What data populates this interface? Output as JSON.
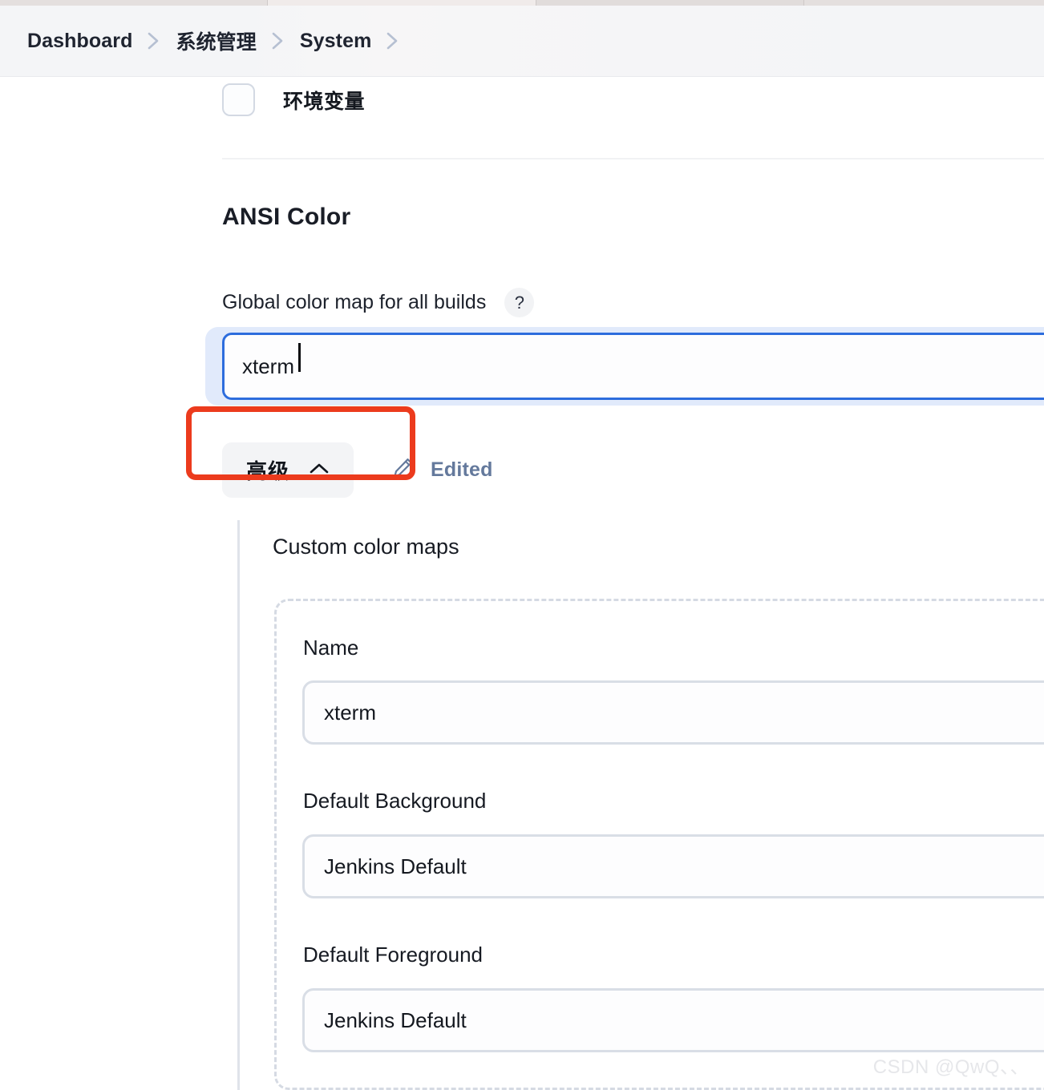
{
  "browser": {
    "tabs": [
      "tab-inactive-left",
      "tab-active",
      "tab-inactive-right",
      "tab-inactive-far-right"
    ]
  },
  "breadcrumb": {
    "items": [
      {
        "label": "Dashboard"
      },
      {
        "label": "系统管理"
      },
      {
        "label": "System"
      }
    ],
    "separator_icon": "chevron-right-icon",
    "trailing_separator": true
  },
  "form": {
    "env_var_checkbox": {
      "label": "环境变量",
      "checked": false
    },
    "ansi_section": {
      "title": "ANSI Color",
      "global_color_map": {
        "label": "Global color map for all builds",
        "help_icon": "?",
        "value": "xterm",
        "placeholder": "",
        "focused": true
      },
      "advanced_button": {
        "label": "高级",
        "chevron_icon": "chevron-up-icon",
        "expanded": true
      },
      "edited_status": {
        "label": "Edited",
        "icon": "pencil-icon"
      },
      "custom_color_maps": {
        "title": "Custom color maps",
        "entries": [
          {
            "fields": [
              {
                "label": "Name",
                "value": "xterm",
                "placeholder": ""
              },
              {
                "label": "Default Background",
                "value": "Jenkins Default",
                "placeholder": ""
              },
              {
                "label": "Default Foreground",
                "value": "Jenkins Default",
                "placeholder": ""
              }
            ]
          }
        ]
      }
    }
  },
  "annotation": {
    "type": "red-rectangle-highlight",
    "color": "#ec3b1d",
    "target": "global-color-map-input"
  },
  "watermark": {
    "text": "CSDN @QwQ、、"
  },
  "colors": {
    "focus_blue": "#2d6ddd",
    "focus_glow": "#e1eafb",
    "annotation_red": "#ec3b1d",
    "text_primary": "#14181f",
    "link_slate": "#64799c",
    "border_gray": "#d9dee6",
    "dashed_border": "#d5dae3"
  }
}
